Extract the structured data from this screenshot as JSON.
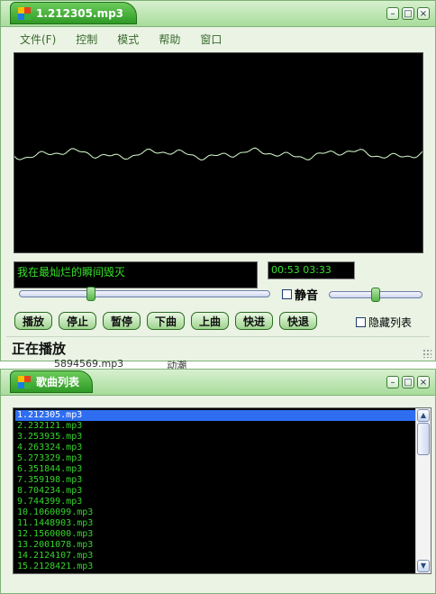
{
  "player": {
    "title": "1.212305.mp3",
    "menu": [
      "文件(F)",
      "控制",
      "模式",
      "帮助",
      "窗口"
    ],
    "lyric": "我在最灿烂的瞬间毁灭",
    "time": "00:53 03:33",
    "mute_label": "静音",
    "progress_fraction": 0.28,
    "volume_fraction": 0.5,
    "buttons": [
      "播放",
      "停止",
      "暂停",
      "下曲",
      "上曲",
      "快进",
      "快退"
    ],
    "hide_list_label": "隐藏列表",
    "status": "正在播放"
  },
  "behind_window_text": [
    "5894569.mp3",
    "动潮"
  ],
  "playlist": {
    "title": "歌曲列表",
    "selected_index": 0,
    "items": [
      "1.212305.mp3",
      "2.232121.mp3",
      "3.253935.mp3",
      "4.263324.mp3",
      "5.273329.mp3",
      "6.351844.mp3",
      "7.359198.mp3",
      "8.704234.mp3",
      "9.744399.mp3",
      "10.1060099.mp3",
      "11.1448903.mp3",
      "12.1560000.mp3",
      "13.2001078.mp3",
      "14.2124107.mp3",
      "15.2128421.mp3"
    ]
  },
  "colors": {
    "title_green": "#2f9a26",
    "display_green": "#37e22b",
    "selection_blue": "#2f6df0",
    "wave_line": "#d8ffd0"
  }
}
